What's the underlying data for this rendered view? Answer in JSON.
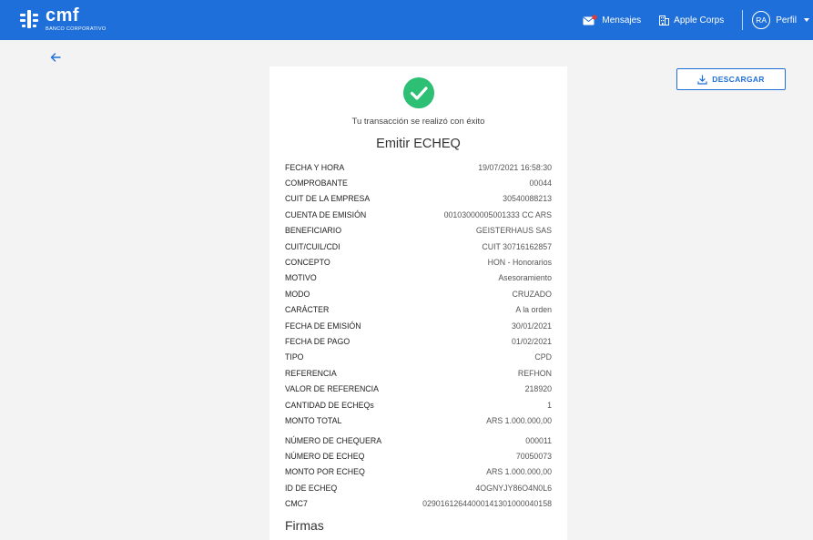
{
  "header": {
    "brand_name": "cmf",
    "brand_sub": "BANCO CORPORATIVO",
    "messages_label": "Mensajes",
    "company_label": "Apple Corps",
    "avatar_initials": "RA",
    "profile_label": "Perfil"
  },
  "actions": {
    "download_label": "DESCARGAR"
  },
  "receipt": {
    "success_message": "Tu transacción se realizó con éxito",
    "title": "Emitir ECHEQ",
    "details": [
      {
        "label": "FECHA Y HORA",
        "value": "19/07/2021 16:58:30"
      },
      {
        "label": "COMPROBANTE",
        "value": "00044"
      },
      {
        "label": "CUIT DE LA EMPRESA",
        "value": "30540088213"
      },
      {
        "label": "CUENTA DE EMISIÓN",
        "value": "00103000005001333  CC ARS"
      },
      {
        "label": "BENEFICIARIO",
        "value": "GEISTERHAUS SAS"
      },
      {
        "label": "CUIT/CUIL/CDI",
        "value": "CUIT 30716162857"
      },
      {
        "label": "CONCEPTO",
        "value": "HON - Honorarios"
      },
      {
        "label": "MOTIVO",
        "value": "Asesoramiento"
      },
      {
        "label": "MODO",
        "value": "CRUZADO"
      },
      {
        "label": "CARÁCTER",
        "value": "A la orden"
      },
      {
        "label": "FECHA DE EMISIÓN",
        "value": "30/01/2021"
      },
      {
        "label": "FECHA DE PAGO",
        "value": "01/02/2021"
      },
      {
        "label": "TIPO",
        "value": "CPD"
      },
      {
        "label": "REFERENCIA",
        "value": "REFHON"
      },
      {
        "label": "VALOR DE REFERENCIA",
        "value": "218920"
      },
      {
        "label": "CANTIDAD DE ECHEQs",
        "value": "1"
      },
      {
        "label": "MONTO TOTAL",
        "value": "ARS 1.000.000,00"
      }
    ],
    "cheque_details": [
      {
        "label": "NÚMERO DE CHEQUERA",
        "value": "000011"
      },
      {
        "label": "NÚMERO DE ECHEQ",
        "value": "70050073"
      },
      {
        "label": "MONTO POR ECHEQ",
        "value": "ARS 1.000.000,00"
      },
      {
        "label": "ID DE ECHEQ",
        "value": "4OGNYJY86O4N0L6"
      },
      {
        "label": "CMC7",
        "value": "02901612644000141301000040158"
      }
    ],
    "signatures_heading": "Firmas"
  },
  "colors": {
    "header_bg": "#1e6fd9",
    "success_green": "#2dbf74",
    "page_bg": "#f3f3f3"
  }
}
